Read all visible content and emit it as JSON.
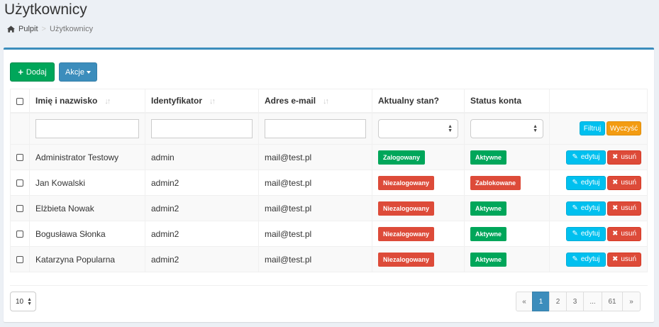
{
  "header": {
    "title": "Użytkownicy",
    "breadcrumb": {
      "home": "Pulpit",
      "separator": ">",
      "current": "Użytkownicy"
    }
  },
  "toolbar": {
    "add_label": "Dodaj",
    "actions_label": "Akcje"
  },
  "table": {
    "columns": [
      "Imię i nazwisko",
      "Identyfikator",
      "Adres e-mail",
      "Aktualny stan?",
      "Status konta"
    ],
    "filter_label": "Filtruj",
    "clear_label": "Wyczyść",
    "edit_label": "edytuj",
    "delete_label": "usuń",
    "rows": [
      {
        "name": "Administrator Testowy",
        "id": "admin",
        "email": "mail@test.pl",
        "state": "Zalogowany",
        "state_color": "#00a65a",
        "status": "Aktywne",
        "status_color": "#00a65a"
      },
      {
        "name": "Jan Kowalski",
        "id": "admin2",
        "email": "mail@test.pl",
        "state": "Niezalogowany",
        "state_color": "#dd4b39",
        "status": "Zablokowane",
        "status_color": "#dd4b39"
      },
      {
        "name": "Elżbieta Nowak",
        "id": "admin2",
        "email": "mail@test.pl",
        "state": "Niezalogowany",
        "state_color": "#dd4b39",
        "status": "Aktywne",
        "status_color": "#00a65a"
      },
      {
        "name": "Bogusława Słonka",
        "id": "admin2",
        "email": "mail@test.pl",
        "state": "Niezalogowany",
        "state_color": "#dd4b39",
        "status": "Aktywne",
        "status_color": "#00a65a"
      },
      {
        "name": "Katarzyna Popularna",
        "id": "admin2",
        "email": "mail@test.pl",
        "state": "Niezalogowany",
        "state_color": "#dd4b39",
        "status": "Aktywne",
        "status_color": "#00a65a"
      }
    ]
  },
  "footer": {
    "per_page": "10",
    "pagination": {
      "prev": "«",
      "pages": [
        "1",
        "2",
        "3",
        "...",
        "61"
      ],
      "next": "»",
      "active": "1"
    }
  },
  "colors": {
    "accent": "#3c8dbc",
    "success": "#00a65a",
    "danger": "#dd4b39",
    "info": "#00c0ef",
    "warning": "#f39c12"
  }
}
